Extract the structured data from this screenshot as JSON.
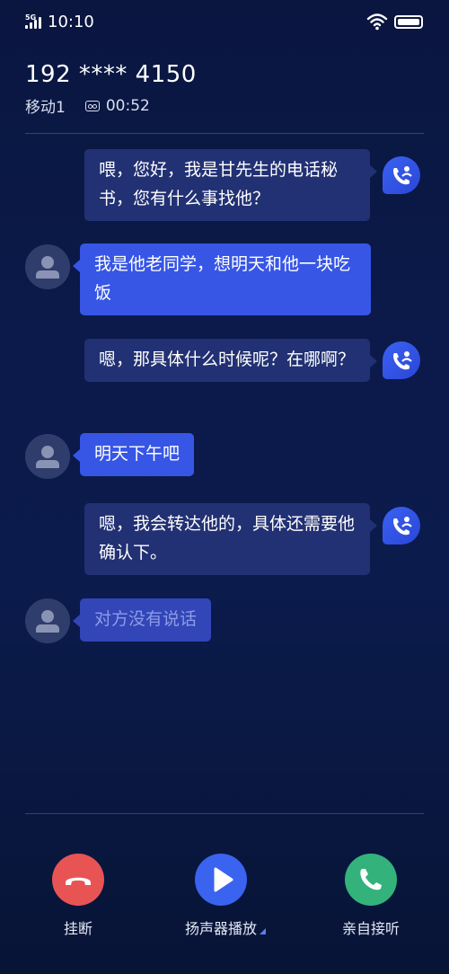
{
  "status_bar": {
    "network": "5G",
    "time": "10:10"
  },
  "call": {
    "number": "192 **** 4150",
    "carrier": "移动1",
    "duration": "00:52"
  },
  "messages": [
    {
      "side": "outgoing",
      "text": "喂，您好，我是甘先生的电话秘书，您有什么事找他？"
    },
    {
      "side": "incoming",
      "text": "我是他老同学，想明天和他一块吃饭"
    },
    {
      "side": "outgoing",
      "text": "嗯，那具体什么时候呢？在哪啊？"
    },
    {
      "side": "incoming",
      "text": "明天下午吧"
    },
    {
      "side": "outgoing",
      "text": "嗯，我会转达他的，具体还需要他确认下。"
    },
    {
      "side": "incoming",
      "text": "对方没有说话"
    }
  ],
  "controls": {
    "hangup": "挂断",
    "speaker": "扬声器播放",
    "answer": "亲自接听"
  },
  "colors": {
    "hangup": "#e85454",
    "speaker": "#3a63f0",
    "answer": "#33b27b",
    "incoming_bubble": "#3756e6",
    "outgoing_bubble": "#223173"
  }
}
